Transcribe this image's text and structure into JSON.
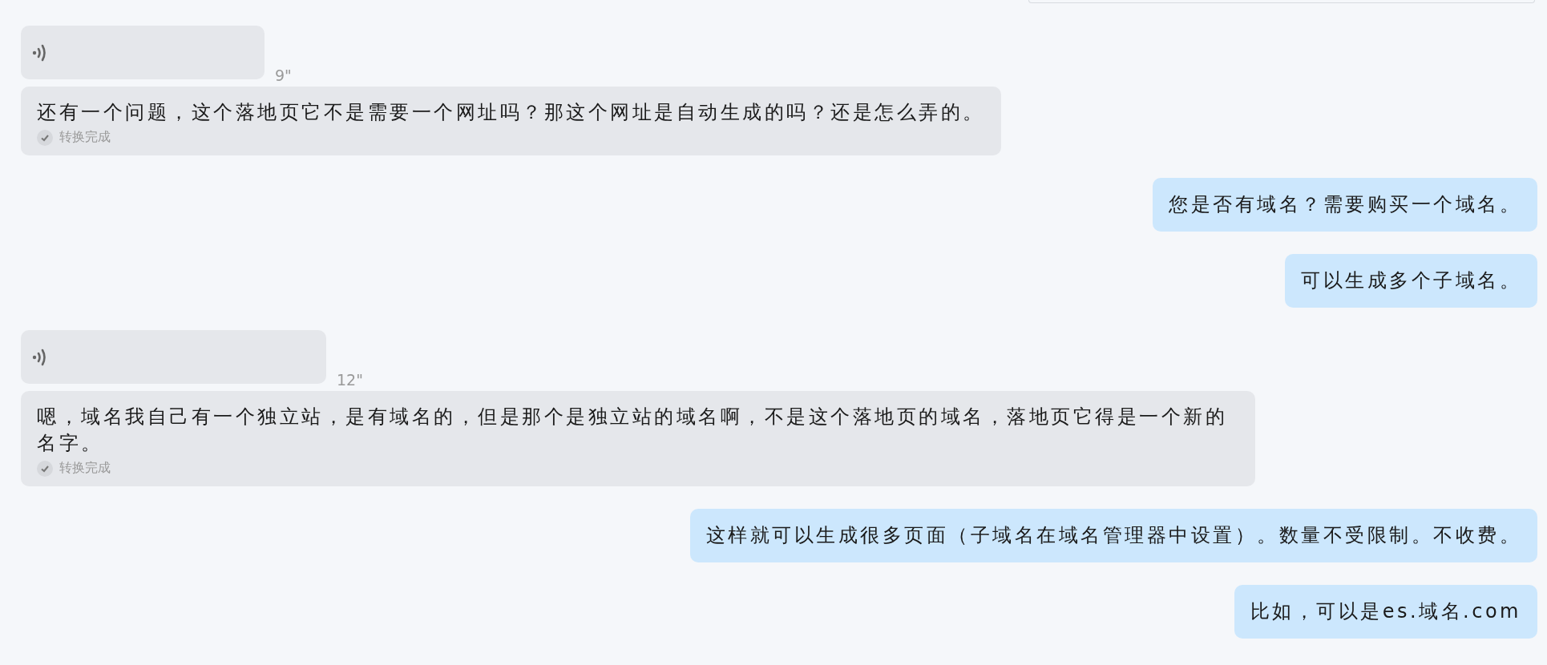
{
  "messages": [
    {
      "kind": "voice",
      "duration": "9\""
    },
    {
      "kind": "transcript",
      "text": "还有一个问题，这个落地页它不是需要一个网址吗？那这个网址是自动生成的吗？还是怎么弄的。",
      "status": "转换完成"
    },
    {
      "kind": "reply",
      "text": "您是否有域名？需要购买一个域名。"
    },
    {
      "kind": "reply",
      "text": "可以生成多个子域名。"
    },
    {
      "kind": "voice",
      "duration": "12\""
    },
    {
      "kind": "transcript",
      "text": "嗯，域名我自己有一个独立站，是有域名的，但是那个是独立站的域名啊，不是这个落地页的域名，落地页它得是一个新的名字。",
      "status": "转换完成"
    },
    {
      "kind": "reply",
      "text": "这样就可以生成很多页面（子域名在域名管理器中设置）。数量不受限制。不收费。"
    },
    {
      "kind": "reply",
      "text": "比如，可以是es.域名.com"
    }
  ]
}
